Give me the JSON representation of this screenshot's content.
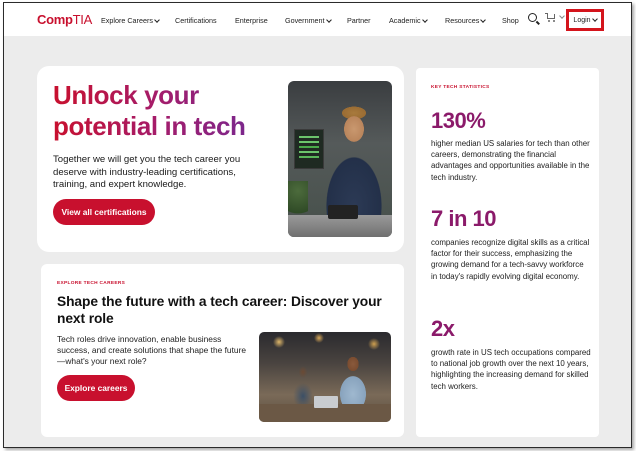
{
  "brand": {
    "logo_bold": "Comp",
    "logo_light": "TIA",
    "accent": "#c8102e"
  },
  "nav": {
    "items": [
      "Explore Careers",
      "Certifications",
      "Enterprise",
      "Government",
      "Partner",
      "Academic",
      "Resources",
      "Shop"
    ],
    "login": "Login",
    "highlight_color": "#d4141c"
  },
  "hero": {
    "heading": "Unlock your potential in tech",
    "body": "Together we will get you the tech career you deserve with industry-leading certifications, training, and expert knowledge.",
    "cta": "View all certifications"
  },
  "careers": {
    "eyebrow": "EXPLORE TECH CAREERS",
    "heading": "Shape the future with a tech career: Discover your next role",
    "body": "Tech roles drive innovation, enable business success, and create solutions that shape the future—what's your next role?",
    "cta": "Explore careers"
  },
  "stats": {
    "eyebrow": "KEY TECH STATISTICS",
    "items": [
      {
        "value": "130%",
        "desc": "higher median US salaries for tech than other careers, demonstrating the financial advantages and opportunities available in the tech industry."
      },
      {
        "value": "7 in 10",
        "desc": "companies recognize digital skills as a critical factor for their success, emphasizing the growing demand for a tech-savvy workforce in today's rapidly evolving digital economy."
      },
      {
        "value": "2x",
        "desc": "growth rate in US tech occupations compared to national job growth over the next 10 years, highlighting the increasing demand for skilled tech workers."
      }
    ],
    "value_color": "#8b1a6a"
  }
}
